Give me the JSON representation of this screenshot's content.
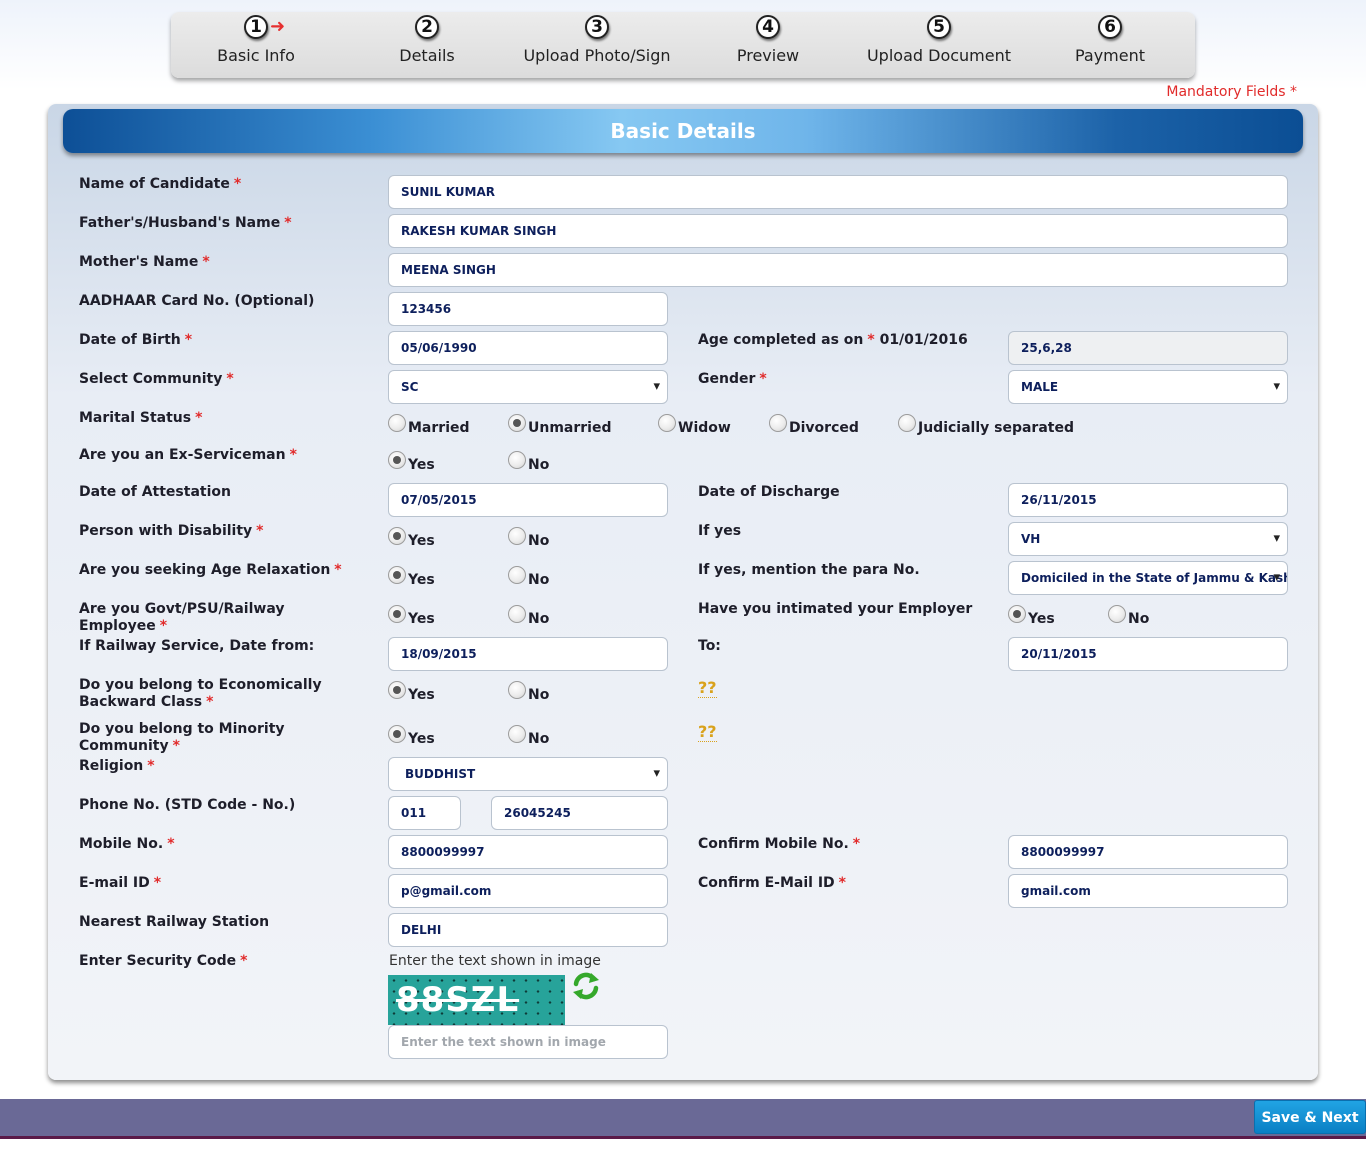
{
  "stepper": [
    {
      "num": "1",
      "label": "Basic Info"
    },
    {
      "num": "2",
      "label": "Details"
    },
    {
      "num": "3",
      "label": "Upload Photo/Sign"
    },
    {
      "num": "4",
      "label": "Preview"
    },
    {
      "num": "5",
      "label": "Upload Document"
    },
    {
      "num": "6",
      "label": "Payment"
    }
  ],
  "mandatory_note": "Mandatory Fields",
  "required_mark": "*",
  "panel_title": "Basic Details",
  "labels": {
    "name": "Name of Candidate",
    "father": "Father's/Husband's Name",
    "mother": "Mother's Name",
    "aadhaar": "AADHAAR Card No. (Optional)",
    "dob": "Date of Birth",
    "age": "Age completed as on",
    "age_date": "01/01/2016",
    "community": "Select Community",
    "gender": "Gender",
    "marital": "Marital Status",
    "exservice": "Are you an Ex-Serviceman",
    "attestation": "Date of Attestation",
    "discharge": "Date of Discharge",
    "disability": "Person with Disability",
    "if_yes": "If yes",
    "age_relax": "Are you seeking Age Relaxation",
    "para_no": "If yes, mention the para No.",
    "govt_emp": "Are you Govt/PSU/Railway Employee",
    "intimated": "Have you intimated your Employer",
    "railway_from": "If Railway Service, Date from:",
    "to": "To:",
    "ebc": "Do you belong to Economically Backward Class",
    "minority": "Do you belong to Minority Community",
    "religion": "Religion",
    "phone": "Phone No. (STD Code - No.)",
    "mobile": "Mobile No.",
    "confirm_mobile": "Confirm Mobile No.",
    "email": "E-mail ID",
    "confirm_email": "Confirm E-Mail ID",
    "station": "Nearest Railway Station",
    "security": "Enter Security Code"
  },
  "values": {
    "name": "SUNIL KUMAR",
    "father": "RAKESH KUMAR SINGH",
    "mother": "MEENA SINGH",
    "aadhaar": "123456",
    "dob": "05/06/1990",
    "age": "25,6,28",
    "community": "SC",
    "gender": "MALE",
    "attestation": "07/05/2015",
    "discharge": "26/11/2015",
    "disability_type": "VH",
    "para_no": "Domiciled in the State of Jammu & Kash",
    "railway_from": "18/09/2015",
    "railway_to": "20/11/2015",
    "religion": "BUDDHIST",
    "std_code": "011",
    "phone_no": "26045245",
    "mobile": "8800099997",
    "confirm_mobile": "8800099997",
    "email": "p@gmail.com",
    "confirm_email": "gmail.com",
    "station": "DELHI"
  },
  "marital_options": [
    "Married",
    "Unmarried",
    "Widow",
    "Divorced",
    "Judicially separated"
  ],
  "yes": "Yes",
  "no": "No",
  "help_mark": "??",
  "captcha": {
    "hint": "Enter the text shown in image",
    "text": "88SZL",
    "placeholder": "Enter the text shown in image"
  },
  "save_button": "Save & Next",
  "colors": {
    "header_blue": "#0d4f96",
    "required_red": "#e12b2b",
    "footer_purple": "#6a6996",
    "button_blue": "#0a7fc4"
  }
}
